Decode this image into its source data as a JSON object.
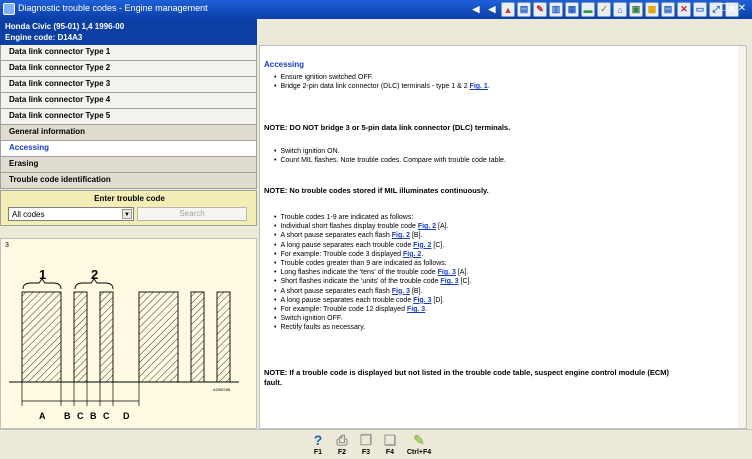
{
  "window": {
    "title": "Diagnostic trouble codes - Engine management",
    "toolbar_icons": [
      "first-page-icon",
      "prev-page-icon",
      "warning-icon",
      "doc-icon",
      "wrench-icon",
      "document-icon",
      "engine-icon",
      "battery-icon",
      "checklist-icon",
      "home-icon",
      "photo-icon",
      "calculator-icon",
      "chart-icon",
      "tools-icon",
      "map-icon",
      "resize-icon",
      "close-icon"
    ]
  },
  "vehicle": {
    "line1": "Honda   Civic (95-01) 1,4  1996-00",
    "line2": "Engine code: D14A3"
  },
  "nav": [
    "Data link connector  Type 1",
    "Data link connector  Type 2",
    "Data link connector  Type 3",
    "Data link connector  Type 4",
    "Data link connector  Type 5",
    "General information",
    "Accessing",
    "Erasing",
    "Trouble code identification"
  ],
  "trouble": {
    "label": "Enter trouble code",
    "select_value": "All codes",
    "search_label": "Search"
  },
  "figure": {
    "number": "3",
    "ref": "A20M788",
    "labels": [
      "1",
      "2"
    ],
    "bottom_letters": [
      "A",
      "B",
      "C",
      "B",
      "C",
      "D"
    ]
  },
  "content": {
    "heading": "Accessing",
    "group1": [
      {
        "text": "Ensure ignition switched OFF.",
        "link": ""
      },
      {
        "text": "Bridge 2-pin data link connector (DLC) terminals - type 1 & 2 ",
        "link": "Fig. 1",
        "tail": "."
      }
    ],
    "note1": "NOTE: DO NOT bridge 3 or 5-pin data link connector (DLC) terminals.",
    "group2": [
      {
        "text": "Switch ignition ON.",
        "link": ""
      },
      {
        "text": "Count MIL flashes. Note trouble codes. Compare with trouble code table.",
        "link": ""
      }
    ],
    "note2": "NOTE: No trouble codes stored if MIL illuminates continuously.",
    "group3": [
      {
        "text": "Trouble codes 1-9 are indicated as follows:",
        "link": ""
      },
      {
        "text": "Individual short flashes display trouble code ",
        "link": "Fig. 2",
        "tail": " [A]."
      },
      {
        "text": "A short pause separates each flash ",
        "link": "Fig. 2",
        "tail": " [B]."
      },
      {
        "text": "A long pause separates each trouble code ",
        "link": "Fig. 2",
        "tail": " [C]."
      },
      {
        "text": "For example: Trouble code 3 displayed ",
        "link": "Fig. 2",
        "tail": "."
      },
      {
        "text": "Trouble codes greater than 9 are indicated as follows:",
        "link": ""
      },
      {
        "text": "Long flashes indicate the 'tens' of the trouble code ",
        "link": "Fig. 3",
        "tail": " [A]."
      },
      {
        "text": "Short flashes indicate the 'units' of the trouble code ",
        "link": "Fig. 3",
        "tail": " [C]."
      },
      {
        "text": "A short pause separates each flash ",
        "link": "Fig. 3",
        "tail": " [B]."
      },
      {
        "text": "A long pause separates each trouble code ",
        "link": "Fig. 3",
        "tail": " [D]."
      },
      {
        "text": "For example: Trouble code 12 displayed ",
        "link": "Fig. 3",
        "tail": "."
      },
      {
        "text": "Switch ignition OFF.",
        "link": ""
      },
      {
        "text": "Rectify faults as necessary.",
        "link": ""
      }
    ],
    "note3_line1": "NOTE: If a trouble code is displayed but not listed in the trouble code table, suspect engine control module (ECM)",
    "note3_line2": "fault."
  },
  "bottom": [
    {
      "label": "F1",
      "icon": "help-icon",
      "color": "#2060c0"
    },
    {
      "label": "F2",
      "icon": "print-icon",
      "color": "#909090"
    },
    {
      "label": "F3",
      "icon": "copy-icon",
      "color": "#a0a0a0"
    },
    {
      "label": "F4",
      "icon": "pages-icon",
      "color": "#a0a0a0"
    },
    {
      "label": "Ctrl+F4",
      "icon": "edit-icon",
      "color": "#a0c060"
    }
  ]
}
